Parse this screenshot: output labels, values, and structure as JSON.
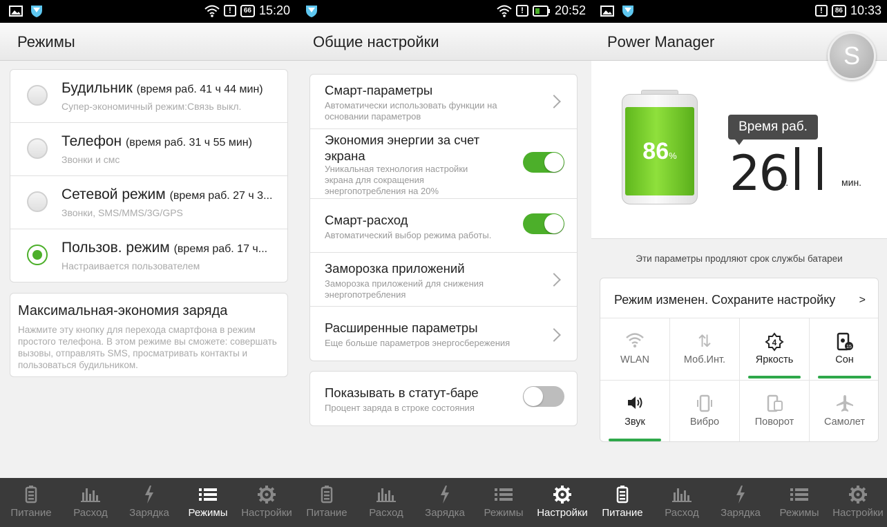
{
  "panels": {
    "p1": {
      "status": {
        "time": "15:20",
        "battery": "66"
      },
      "title": "Режимы",
      "modes": [
        {
          "name": "Будильник",
          "runtime": "(время раб. 41 ч 44 мин)",
          "desc": "Супер-экономичный режим:Связь выкл.",
          "selected": false
        },
        {
          "name": "Телефон",
          "runtime": "(время раб. 31 ч 55 мин)",
          "desc": "Звонки и смс",
          "selected": false
        },
        {
          "name": "Сетевой режим",
          "runtime": "(время раб. 27 ч 3...",
          "desc": "Звонки, SMS/MMS/3G/GPS",
          "selected": false
        },
        {
          "name": "Пользов. режим",
          "runtime": "(время раб. 17 ч...",
          "desc": "Настраивается пользователем",
          "selected": true
        }
      ],
      "max_saving": {
        "title": "Максимальная-экономия заряда",
        "desc": "Нажмите эту кнопку для перехода смартфона в режим простого телефона. В этом режиме вы сможете: совершать вызовы, отправлять SMS, просматривать контакты и пользоваться будильником."
      }
    },
    "p2": {
      "status": {
        "time": "20:52"
      },
      "title": "Общие настройки",
      "settings": [
        {
          "title": "Смарт-параметры",
          "desc": "Автоматически использовать функции на основании параметров"
        },
        {
          "title": "Экономия энергии за счет экрана",
          "desc": "Уникальная технология настройки экрана для сокращения энергопотребления на 20%",
          "toggle": "on"
        },
        {
          "title": "Смарт-расход",
          "desc": "Автоматический выбор режима работы.",
          "toggle": "on"
        },
        {
          "title": "Заморозка приложений",
          "desc": "Заморозка приложений для снижения энергопотребления"
        },
        {
          "title": "Расширенные параметры",
          "desc": "Еще больше параметров энергосбережения"
        }
      ],
      "statusbar_setting": {
        "title": "Показывать в статут-баре",
        "desc": "Процент заряда в строке состояния",
        "toggle": "off"
      }
    },
    "p3": {
      "status": {
        "time": "10:33",
        "battery": "86"
      },
      "title": "Power Manager",
      "avatar_letter": "S",
      "battery_percent": "86",
      "battery_percent_sign": "%",
      "battery_level": 0.86,
      "runtime_label": "Время раб.",
      "runtime_hours": "26",
      "runtime_hours_unit": "ч.",
      "runtime_minutes": "11",
      "runtime_minutes_unit": "мин.",
      "hint": "Эти параметры продляют срок службы батареи",
      "mode_changed": "Режим изменен. Сохраните настройку",
      "mode_changed_arrow": ">",
      "toggles": [
        {
          "label": "WLAN",
          "icon": "wifi-icon",
          "active": false
        },
        {
          "label": "Моб.Инт.",
          "icon": "mobile-data-icon",
          "active": false
        },
        {
          "label": "Яркость",
          "icon": "brightness-icon",
          "active": true
        },
        {
          "label": "Сон",
          "icon": "sleep-icon",
          "active": true
        },
        {
          "label": "Звук",
          "icon": "sound-icon",
          "active": true
        },
        {
          "label": "Вибро",
          "icon": "vibrate-icon",
          "active": false
        },
        {
          "label": "Поворот",
          "icon": "rotate-icon",
          "active": false
        },
        {
          "label": "Самолет",
          "icon": "airplane-icon",
          "active": false
        }
      ]
    }
  },
  "nav": {
    "p1": [
      {
        "label": "Питание",
        "icon": "battery-icon",
        "active": false
      },
      {
        "label": "Расход",
        "icon": "bar-chart-icon",
        "active": false
      },
      {
        "label": "Зарядка",
        "icon": "lightning-icon",
        "active": false
      },
      {
        "label": "Режимы",
        "icon": "list-icon",
        "active": true
      },
      {
        "label": "Настройки",
        "icon": "gear-icon",
        "active": false
      }
    ],
    "p2": [
      {
        "label": "Питание",
        "icon": "battery-icon",
        "active": false
      },
      {
        "label": "Расход",
        "icon": "bar-chart-icon",
        "active": false
      },
      {
        "label": "Зарядка",
        "icon": "lightning-icon",
        "active": false
      },
      {
        "label": "Режимы",
        "icon": "list-icon",
        "active": false
      },
      {
        "label": "Настройки",
        "icon": "gear-icon",
        "active": true
      }
    ],
    "p3": [
      {
        "label": "Питание",
        "icon": "battery-icon",
        "active": true
      },
      {
        "label": "Расход",
        "icon": "bar-chart-icon",
        "active": false
      },
      {
        "label": "Зарядка",
        "icon": "lightning-icon",
        "active": false
      },
      {
        "label": "Режимы",
        "icon": "list-icon",
        "active": false
      },
      {
        "label": "Настройки",
        "icon": "gear-icon",
        "active": false
      }
    ]
  },
  "colors": {
    "accent_green": "#4caf2a",
    "nav_bg": "#3a3a3a",
    "indicator_green": "#2ea84a"
  }
}
